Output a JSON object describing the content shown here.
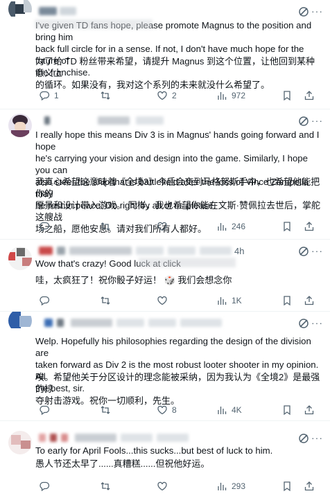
{
  "replies": [
    {
      "text_en_lines": [
        "I've given TD fans hope, please promote Magnus to the position and bring him",
        "back full circle for in a sense. If not, I don't have much hope for the future of",
        "the franchise."
      ],
      "text_cn_lines": [
        "为了给 TD 粉丝带来希望，请提升 Magnus 到这个位置，让他回到某种意义上",
        "的循环。如果没有，我对这个系列的未来就没什么希望了。"
      ],
      "stats": {
        "replies": "1",
        "retweets": "",
        "likes": "2",
        "views": "972"
      }
    },
    {
      "text_en_lines": [
        "I really hope this means Div 3 is in Magnus' hands going forward and I hope",
        "he's carrying your vision and design into the game.  Similarly, I hope you can",
        "also steer the ship that is battlefield after the loss of Vince Zampella may",
        "he rest in peace.  Do right by all of us please."
      ],
      "text_cn_lines": [
        "我真心希望这意味着《全境3》今后会交到马格努斯手中，也希望他能把你的",
        "愿景和设计带入游戏。 同样，我也希望你能在文斯·赞佩拉去世后，掌舵这艘战",
        "场之船，愿他安息。请对我们所有人都好。"
      ],
      "stats": {
        "replies": "",
        "retweets": "",
        "likes": "",
        "views": "246"
      }
    },
    {
      "time": "4h",
      "text_en_lines": [
        "Wow that's crazy! Good luck at click"
      ],
      "text_cn_lines": [
        "哇，太疯狂了！祝你骰子好运！  🎲  我们会想念你"
      ],
      "stats": {
        "replies": "",
        "retweets": "",
        "likes": "",
        "views": "1K"
      }
    },
    {
      "text_en_lines": [
        "Welp. Hopefully his philosophies regarding the design of the division are",
        "taken forward as Div 2 is the most robust looter shooter in my opinion. All",
        "the best, sir."
      ],
      "text_cn_lines": [
        "唉。希望他关于分区设计的理念能被采纳，因为我认为《全境2》是最强的掠",
        "夺射击游戏。祝你一切顺利，先生。"
      ],
      "stats": {
        "replies": "",
        "retweets": "",
        "likes": "8",
        "views": "4K"
      }
    },
    {
      "text_en_lines": [
        "To early for April Fools...this sucks...but best of luck to him."
      ],
      "text_cn_lines": [
        "愚人节还太早了......真糟糕......但祝他好运。"
      ],
      "stats": {
        "replies": "",
        "retweets": "",
        "likes": "",
        "views": "293"
      }
    }
  ],
  "icons": [
    "grok-icon",
    "more-icon",
    "reply-icon",
    "retweet-icon",
    "like-icon",
    "views-icon",
    "bookmark-icon",
    "share-icon"
  ]
}
